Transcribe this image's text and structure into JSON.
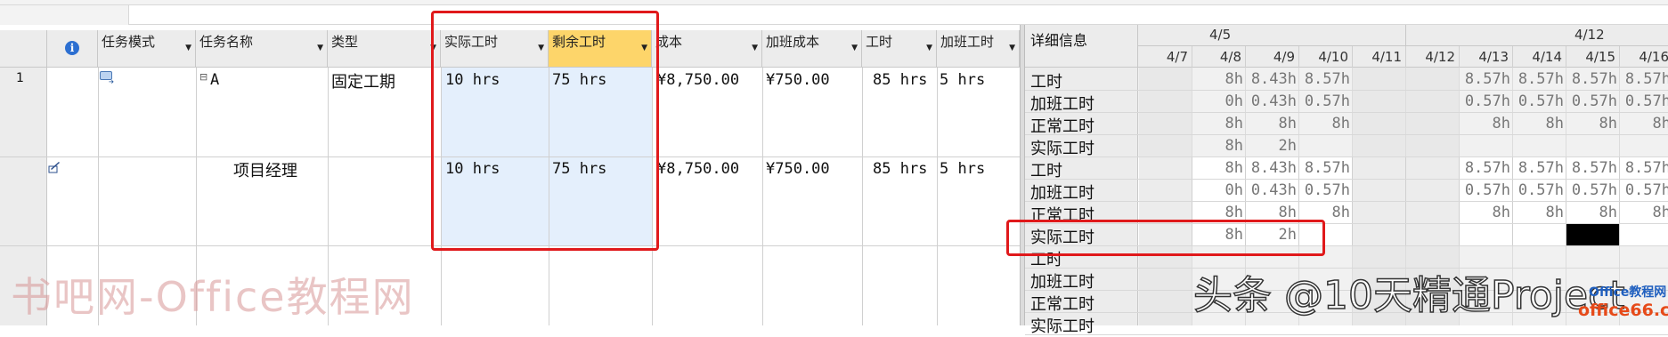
{
  "columns": {
    "info_icon": "i",
    "task_mode": "任务模式",
    "task_name": "任务名称",
    "type": "类型",
    "actual_work": "实际工时",
    "remaining_work": "剩余工时",
    "cost": "成本",
    "overtime_cost": "加班成本",
    "work": "工时",
    "overtime_work": "加班工时"
  },
  "rows": [
    {
      "id": "1",
      "collapse": "⊟",
      "name": "A",
      "type": "固定工期",
      "actual_work": "10 hrs",
      "remaining_work": "75 hrs",
      "cost": "¥8,750.00",
      "overtime_cost": "¥750.00",
      "work": "85 hrs",
      "overtime_work": "5 hrs"
    },
    {
      "id": "",
      "name": "项目经理",
      "type": "",
      "actual_work": "10 hrs",
      "remaining_work": "75 hrs",
      "cost": "¥8,750.00",
      "overtime_cost": "¥750.00",
      "work": "85 hrs",
      "overtime_work": "5 hrs"
    }
  ],
  "timephased": {
    "details_header": "详细信息",
    "weeks": [
      "4/5",
      "4/12"
    ],
    "days": [
      "4/7",
      "4/8",
      "4/9",
      "4/10",
      "4/11",
      "4/12",
      "4/13",
      "4/14",
      "4/15",
      "4/16"
    ],
    "labels": [
      "工时",
      "加班工时",
      "正常工时",
      "实际工时"
    ],
    "task_rows": [
      [
        "",
        "8h",
        "8.43h",
        "8.57h",
        "",
        "",
        "8.57h",
        "8.57h",
        "8.57h",
        "8.57h"
      ],
      [
        "",
        "0h",
        "0.43h",
        "0.57h",
        "",
        "",
        "0.57h",
        "0.57h",
        "0.57h",
        "0.57h"
      ],
      [
        "",
        "8h",
        "8h",
        "8h",
        "",
        "",
        "8h",
        "8h",
        "8h",
        "8h"
      ],
      [
        "",
        "8h",
        "2h",
        "",
        "",
        "",
        "",
        "",
        "",
        ""
      ]
    ],
    "resource_rows": [
      [
        "",
        "8h",
        "8.43h",
        "8.57h",
        "",
        "",
        "8.57h",
        "8.57h",
        "8.57h",
        "8.57h"
      ],
      [
        "",
        "0h",
        "0.43h",
        "0.57h",
        "",
        "",
        "0.57h",
        "0.57h",
        "0.57h",
        "0.57h"
      ],
      [
        "",
        "8h",
        "8h",
        "8h",
        "",
        "",
        "8h",
        "8h",
        "8h",
        "8h"
      ],
      [
        "",
        "8h",
        "2h",
        "",
        "",
        "",
        "",
        "",
        "",
        ""
      ]
    ]
  },
  "watermarks": {
    "left": "书吧网-Office教程网",
    "right": "头条 @10天精通Project",
    "logo_top": "Office教程网",
    "logo_bottom": "office66.cn"
  },
  "colors": {
    "highlight": "#e4effc",
    "header_selected": "#fdd56a",
    "annotation": "#e0191b"
  }
}
